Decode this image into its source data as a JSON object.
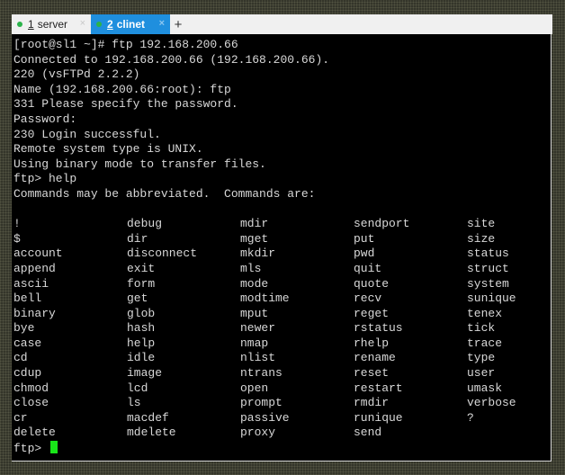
{
  "tabs": [
    {
      "number": "1",
      "label": "server",
      "active": false
    },
    {
      "number": "2",
      "label": "clinet",
      "active": true
    }
  ],
  "new_tab_label": "+",
  "close_glyph": "×",
  "colors": {
    "active_tab": "#1f8fde",
    "status_dot": "#2bb34a",
    "cursor": "#19e619",
    "terminal_bg": "#000000"
  },
  "terminal": {
    "lines": [
      "[root@sl1 ~]# ftp 192.168.200.66",
      "Connected to 192.168.200.66 (192.168.200.66).",
      "220 (vsFTPd 2.2.2)",
      "Name (192.168.200.66:root): ftp",
      "331 Please specify the password.",
      "Password:",
      "230 Login successful.",
      "Remote system type is UNIX.",
      "Using binary mode to transfer files.",
      "ftp> help",
      "Commands may be abbreviated.  Commands are:",
      ""
    ],
    "commands": [
      [
        "!",
        "debug",
        "mdir",
        "sendport",
        "site"
      ],
      [
        "$",
        "dir",
        "mget",
        "put",
        "size"
      ],
      [
        "account",
        "disconnect",
        "mkdir",
        "pwd",
        "status"
      ],
      [
        "append",
        "exit",
        "mls",
        "quit",
        "struct"
      ],
      [
        "ascii",
        "form",
        "mode",
        "quote",
        "system"
      ],
      [
        "bell",
        "get",
        "modtime",
        "recv",
        "sunique"
      ],
      [
        "binary",
        "glob",
        "mput",
        "reget",
        "tenex"
      ],
      [
        "bye",
        "hash",
        "newer",
        "rstatus",
        "tick"
      ],
      [
        "case",
        "help",
        "nmap",
        "rhelp",
        "trace"
      ],
      [
        "cd",
        "idle",
        "nlist",
        "rename",
        "type"
      ],
      [
        "cdup",
        "image",
        "ntrans",
        "reset",
        "user"
      ],
      [
        "chmod",
        "lcd",
        "open",
        "restart",
        "umask"
      ],
      [
        "close",
        "ls",
        "prompt",
        "rmdir",
        "verbose"
      ],
      [
        "cr",
        "macdef",
        "passive",
        "runique",
        "?"
      ],
      [
        "delete",
        "mdelete",
        "proxy",
        "send",
        ""
      ]
    ],
    "prompt": "ftp> "
  }
}
